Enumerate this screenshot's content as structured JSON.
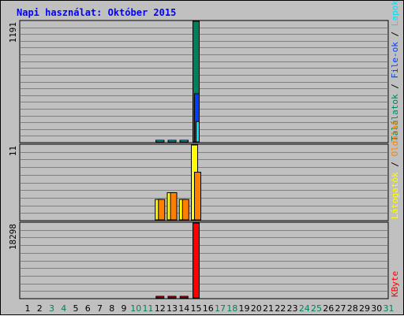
{
  "chart_data": {
    "type": "bar",
    "title": "Napi használat: Október 2015",
    "days": [
      "1",
      "2",
      "3",
      "4",
      "5",
      "6",
      "7",
      "8",
      "9",
      "10",
      "11",
      "12",
      "13",
      "14",
      "15",
      "16",
      "17",
      "18",
      "19",
      "20",
      "21",
      "22",
      "23",
      "24",
      "25",
      "26",
      "27",
      "28",
      "29",
      "30",
      "31"
    ],
    "weekend_days": [
      "3",
      "4",
      "10",
      "11",
      "17",
      "18",
      "24",
      "25",
      "31"
    ],
    "colors": {
      "title": "#0000ff",
      "weekday_label": "#000000",
      "weekend_label": "#00805c",
      "hits": "#00805c",
      "files": "#0040ff",
      "pages": "#00e0ff",
      "visits": "#ffff00",
      "sites": "#ff8000",
      "kbytes": "#ff0000",
      "grid": "#808080",
      "plot_bg": "#c0c0c0"
    },
    "panels": [
      {
        "id": "hits",
        "max_label": "1191",
        "ymax": 1191,
        "legend": [
          {
            "text": "Találatok",
            "color": "#00805c"
          },
          {
            "text": " / ",
            "color": "#000000"
          },
          {
            "text": "File-ok",
            "color": "#0040ff"
          },
          {
            "text": " / ",
            "color": "#000000"
          },
          {
            "text": "Lapok",
            "color": "#00e0ff"
          }
        ],
        "series": [
          {
            "name": "Találatok",
            "color": "#00805c",
            "values": [
              0,
              0,
              0,
              0,
              0,
              0,
              0,
              0,
              0,
              0,
              0,
              2,
              2,
              2,
              1191,
              0,
              0,
              0,
              0,
              0,
              0,
              0,
              0,
              0,
              0,
              0,
              0,
              0,
              0,
              0,
              0
            ]
          },
          {
            "name": "File-ok",
            "color": "#0040ff",
            "values": [
              0,
              0,
              0,
              0,
              0,
              0,
              0,
              0,
              0,
              0,
              0,
              2,
              2,
              2,
              475,
              0,
              0,
              0,
              0,
              0,
              0,
              0,
              0,
              0,
              0,
              0,
              0,
              0,
              0,
              0,
              0
            ]
          },
          {
            "name": "Lapok",
            "color": "#00e0ff",
            "values": [
              0,
              0,
              0,
              0,
              0,
              0,
              0,
              0,
              0,
              0,
              0,
              1,
              1,
              1,
              200,
              0,
              0,
              0,
              0,
              0,
              0,
              0,
              0,
              0,
              0,
              0,
              0,
              0,
              0,
              0,
              0
            ]
          }
        ]
      },
      {
        "id": "visits",
        "max_label": "11",
        "ymax": 11,
        "legend": [
          {
            "text": "Látogatók",
            "color": "#ffff00"
          },
          {
            "text": " / ",
            "color": "#000000"
          },
          {
            "text": "Oldalak",
            "color": "#ff8000"
          }
        ],
        "series": [
          {
            "name": "Látogatók",
            "color": "#ffff00",
            "values": [
              0,
              0,
              0,
              0,
              0,
              0,
              0,
              0,
              0,
              0,
              0,
              3,
              4,
              3,
              11,
              0,
              0,
              0,
              0,
              0,
              0,
              0,
              0,
              0,
              0,
              0,
              0,
              0,
              0,
              0,
              0
            ]
          },
          {
            "name": "Oldalak",
            "color": "#ff8000",
            "values": [
              0,
              0,
              0,
              0,
              0,
              0,
              0,
              0,
              0,
              0,
              0,
              3,
              4,
              3,
              7,
              0,
              0,
              0,
              0,
              0,
              0,
              0,
              0,
              0,
              0,
              0,
              0,
              0,
              0,
              0,
              0
            ]
          }
        ]
      },
      {
        "id": "kbytes",
        "max_label": "18298",
        "ymax": 18298,
        "legend": [
          {
            "text": "KByte",
            "color": "#ff0000"
          }
        ],
        "series": [
          {
            "name": "KByte",
            "color": "#ff0000",
            "values": [
              0,
              0,
              0,
              0,
              0,
              0,
              0,
              0,
              0,
              0,
              0,
              30,
              30,
              30,
              18298,
              0,
              0,
              0,
              0,
              0,
              0,
              0,
              0,
              0,
              0,
              0,
              0,
              0,
              0,
              0,
              0
            ]
          }
        ]
      }
    ]
  }
}
